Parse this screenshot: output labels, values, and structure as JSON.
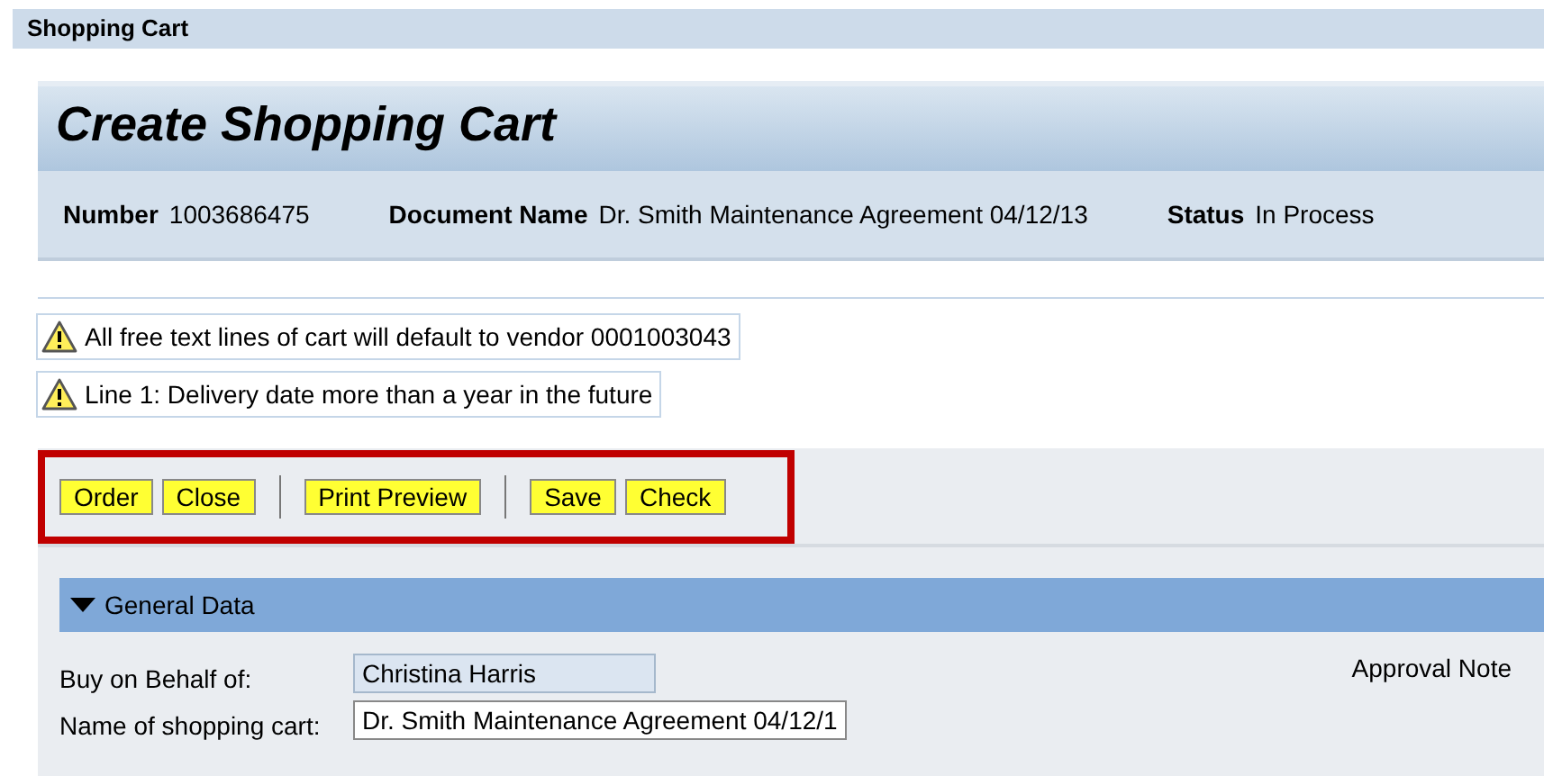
{
  "window": {
    "title": "Shopping Cart"
  },
  "header": {
    "title": "Create Shopping Cart",
    "fields": [
      {
        "label": "Number",
        "value": "1003686475"
      },
      {
        "label": "Document Name",
        "value": "Dr. Smith Maintenance Agreement 04/12/13"
      },
      {
        "label": "Status",
        "value": "In Process"
      }
    ]
  },
  "messages": [
    {
      "kind": "warning",
      "text": "All free text lines of cart will default to vendor 0001003043"
    },
    {
      "kind": "warning",
      "text": "Line 1: Delivery date more than a year in the future"
    }
  ],
  "toolbar": {
    "highlighted": true,
    "items": [
      {
        "kind": "button",
        "label": "Order"
      },
      {
        "kind": "button",
        "label": "Close"
      },
      {
        "kind": "separator"
      },
      {
        "kind": "button",
        "label": "Print Preview"
      },
      {
        "kind": "separator"
      },
      {
        "kind": "button",
        "label": "Save"
      },
      {
        "kind": "button",
        "label": "Check"
      }
    ]
  },
  "general_data": {
    "title": "General Data",
    "expanded": true,
    "approval_note": "Approval Note",
    "fields": [
      {
        "label": "Buy on Behalf of:",
        "value": "Christina Harris",
        "disabled": true
      },
      {
        "label": "Name of shopping cart:",
        "value": "Dr. Smith Maintenance Agreement 04/12/1",
        "disabled": false
      }
    ]
  }
}
